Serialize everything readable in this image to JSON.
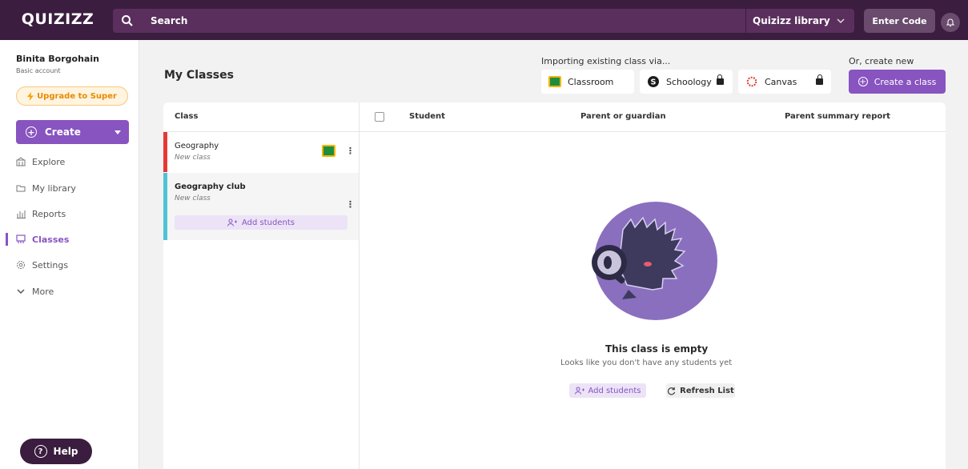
{
  "topbar": {
    "logo": "QUIZIZZ",
    "search_label": "Search",
    "library_label": "Quizizz library",
    "enter_code": "Enter Code"
  },
  "sidebar": {
    "user_name": "Binita Borgohain",
    "account_type": "Basic account",
    "upgrade_label": "Upgrade to Super",
    "create_label": "Create",
    "items": [
      {
        "label": "Explore",
        "icon": "explore-icon"
      },
      {
        "label": "My library",
        "icon": "folder-icon"
      },
      {
        "label": "Reports",
        "icon": "reports-icon"
      },
      {
        "label": "Classes",
        "icon": "classes-icon",
        "active": true
      },
      {
        "label": "Settings",
        "icon": "gear-icon"
      },
      {
        "label": "More",
        "icon": "chevron-down-icon"
      }
    ],
    "help_label": "Help"
  },
  "header": {
    "title": "My Classes",
    "import_label": "Importing existing class via...",
    "create_new_label": "Or, create new",
    "import_options": [
      {
        "label": "Classroom",
        "locked": false
      },
      {
        "label": "Schoology",
        "locked": true
      },
      {
        "label": "Canvas",
        "locked": true
      }
    ],
    "create_class_label": "Create a class"
  },
  "table": {
    "headers": {
      "class": "Class",
      "student": "Student",
      "parent": "Parent or guardian",
      "report": "Parent summary report"
    },
    "classes": [
      {
        "name": "Geography",
        "subtitle": "New class",
        "stripe_color": "#e53935"
      },
      {
        "name": "Geography club",
        "subtitle": "New class",
        "stripe_color": "#4fc3d6",
        "add_students_label": "Add students"
      }
    ]
  },
  "empty_state": {
    "title": "This class is empty",
    "subtitle": "Looks like you don't have any students yet",
    "add_students_label": "Add students",
    "refresh_label": "Refresh List"
  },
  "colors": {
    "topbar": "#3b1d3f",
    "accent": "#8854c0",
    "upgrade": "#e88a00"
  }
}
